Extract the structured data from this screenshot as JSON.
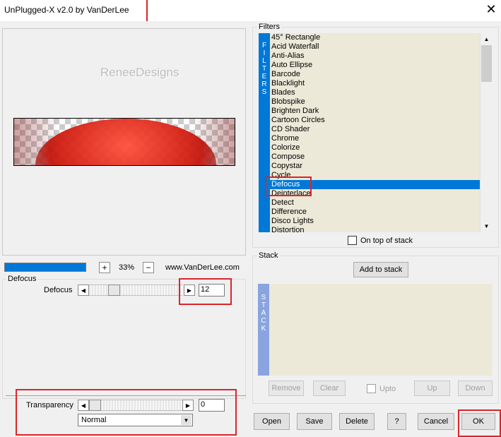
{
  "window": {
    "title": "UnPlugged-X v2.0 by VanDerLee",
    "close_icon": "close-icon"
  },
  "preview": {
    "watermark": "ReneeDesigns",
    "zoom_label": "33%",
    "website": "www.VanDerLee.com",
    "zoom_in": "+",
    "zoom_out": "−"
  },
  "filters": {
    "group_label": "Filters",
    "side_label": [
      "F",
      "I",
      "L",
      "T",
      "E",
      "R",
      "S"
    ],
    "items": [
      "45° Rectangle",
      "Acid Waterfall",
      "Anti-Alias",
      "Auto Ellipse",
      "Barcode",
      "Blacklight",
      "Blades",
      "Blobspike",
      "Brighten Dark",
      "Cartoon Circles",
      "CD Shader",
      "Chrome",
      "Colorize",
      "Compose",
      "Copystar",
      "Cycle",
      "Defocus",
      "Deinterlace",
      "Detect",
      "Difference",
      "Disco Lights",
      "Distortion"
    ],
    "selected": "Defocus",
    "on_top_label": "On top of stack"
  },
  "defocus": {
    "group_label": "Defocus",
    "param_label": "Defocus",
    "value": "12"
  },
  "transparency": {
    "label": "Transparency",
    "value": "0",
    "blend_mode": "Normal"
  },
  "stack": {
    "group_label": "Stack",
    "add_label": "Add to stack",
    "side_label": [
      "S",
      "T",
      "A",
      "C",
      "K"
    ],
    "remove_label": "Remove",
    "clear_label": "Clear",
    "upto_label": "Upto",
    "up_label": "Up",
    "down_label": "Down"
  },
  "buttons": {
    "open": "Open",
    "save": "Save",
    "delete": "Delete",
    "help": "?",
    "cancel": "Cancel",
    "ok": "OK"
  },
  "colors": {
    "accent": "#0078d7",
    "highlight": "#d9262c",
    "list_bg": "#ece9d8",
    "stack_side": "#8aa4e0"
  }
}
